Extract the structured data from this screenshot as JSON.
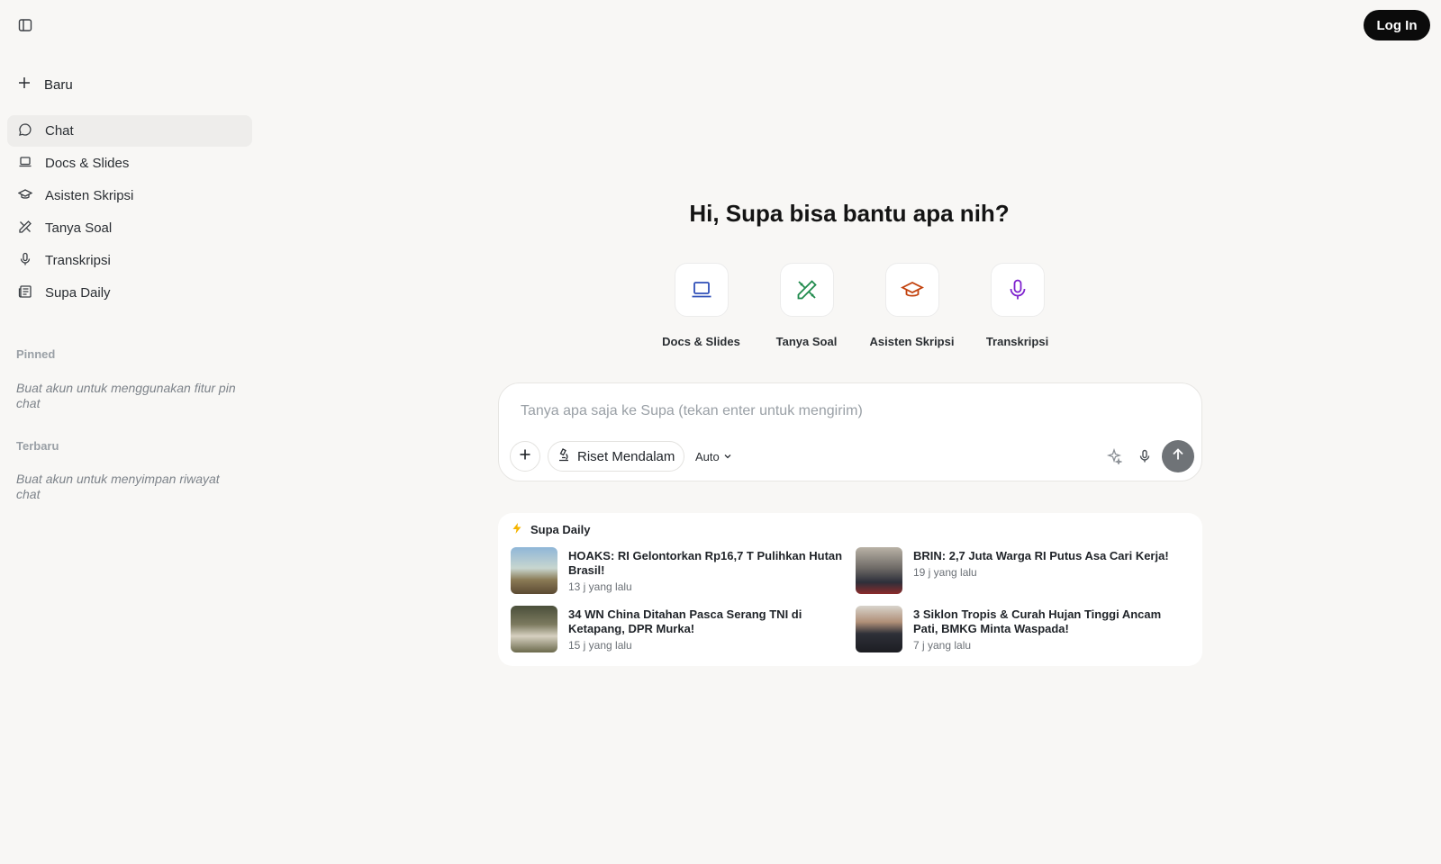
{
  "sidebar": {
    "toggle_icon": "sidebar-panel-icon",
    "new_label": "Baru",
    "items": [
      {
        "label": "Chat",
        "icon": "chat-bubble-icon",
        "active": true
      },
      {
        "label": "Docs & Slides",
        "icon": "laptop-icon"
      },
      {
        "label": "Asisten Skripsi",
        "icon": "graduation-cap-icon"
      },
      {
        "label": "Tanya Soal",
        "icon": "pencil-ruler-icon"
      },
      {
        "label": "Transkripsi",
        "icon": "microphone-icon"
      },
      {
        "label": "Supa Daily",
        "icon": "newspaper-icon"
      }
    ],
    "pinned_title": "Pinned",
    "pinned_note": "Buat akun untuk menggunakan fitur pin chat",
    "recent_title": "Terbaru",
    "recent_note": "Buat akun untuk menyimpan riwayat chat"
  },
  "header": {
    "login_label": "Log In"
  },
  "main": {
    "greeting": "Hi, Supa bisa bantu apa nih?",
    "tools": [
      {
        "label": "Docs & Slides",
        "icon": "laptop-icon",
        "color": "#2f4fb8"
      },
      {
        "label": "Tanya Soal",
        "icon": "pencil-ruler-icon",
        "color": "#1f8a4c"
      },
      {
        "label": "Asisten Skripsi",
        "icon": "graduation-cap-icon",
        "color": "#c2410c"
      },
      {
        "label": "Transkripsi",
        "icon": "microphone-icon",
        "color": "#7e22ce"
      }
    ],
    "chat": {
      "placeholder": "Tanya apa saja ke Supa (tekan enter untuk mengirim)",
      "riset_label": "Riset Mendalam",
      "model_label": "Auto"
    }
  },
  "daily": {
    "title": "Supa Daily",
    "news": [
      {
        "title": "HOAKS: RI Gelontorkan Rp16,7 T Pulihkan Hutan Brasil!",
        "time": "13 j yang lalu"
      },
      {
        "title": "BRIN: 2,7 Juta Warga RI Putus Asa Cari Kerja!",
        "time": "19 j yang lalu"
      },
      {
        "title": "34 WN China Ditahan Pasca Serang TNI di Ketapang, DPR Murka!",
        "time": "15 j yang lalu"
      },
      {
        "title": "3 Siklon Tropis & Curah Hujan Tinggi Ancam Pati, BMKG Minta Waspada!",
        "time": "7 j yang lalu"
      }
    ]
  },
  "colors": {
    "background": "#f8f7f5",
    "active_nav": "#eeedeb",
    "login_bg": "#0b0b0b",
    "send_bg": "#6f7377"
  }
}
